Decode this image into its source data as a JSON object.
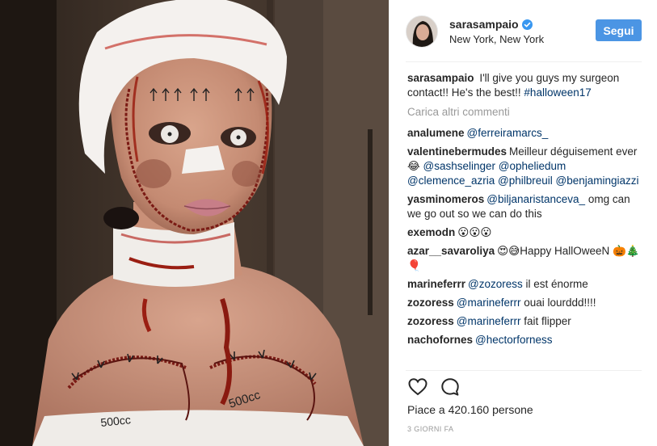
{
  "post": {
    "username": "sarasampaio",
    "location": "New York, New York",
    "follow_label": "Segui",
    "verified": true,
    "caption": {
      "author": "sarasampaio",
      "text": "I'll give you guys my surgeon contact!! He's the best!!",
      "hashtag": "#halloween17"
    },
    "load_more_label": "Carica altri commenti",
    "likes_label": "Piace a 420.160 persone",
    "timestamp": "3 GIORNI FA"
  },
  "comments": [
    {
      "author": "analumene",
      "parts": [
        {
          "t": "mention",
          "v": "@ferreiramarcs_"
        }
      ]
    },
    {
      "author": "valentinebermudes",
      "parts": [
        {
          "t": "text",
          "v": "Meilleur déguisement ever 😂 "
        },
        {
          "t": "mention",
          "v": "@sashselinger"
        },
        {
          "t": "text",
          "v": " "
        },
        {
          "t": "mention",
          "v": "@opheliedum"
        },
        {
          "t": "text",
          "v": " "
        },
        {
          "t": "mention",
          "v": "@clemence_azria"
        },
        {
          "t": "text",
          "v": " "
        },
        {
          "t": "mention",
          "v": "@philbreuil"
        },
        {
          "t": "text",
          "v": " "
        },
        {
          "t": "mention",
          "v": "@benjamingiazzi"
        }
      ]
    },
    {
      "author": "yasminomeros",
      "parts": [
        {
          "t": "mention",
          "v": "@biljanaristanceva_"
        },
        {
          "t": "text",
          "v": " omg can we go out so we can do this"
        }
      ]
    },
    {
      "author": "exemodn",
      "parts": [
        {
          "t": "text",
          "v": "😮😮😮"
        }
      ]
    },
    {
      "author": "azar__savaroliya",
      "parts": [
        {
          "t": "text",
          "v": "😍😅Happy HallOweeN 🎃🎄🎈"
        }
      ]
    },
    {
      "author": "marineferrr",
      "parts": [
        {
          "t": "mention",
          "v": "@zozoress"
        },
        {
          "t": "text",
          "v": " il est énorme"
        }
      ]
    },
    {
      "author": "zozoress",
      "parts": [
        {
          "t": "mention",
          "v": "@marineferrr"
        },
        {
          "t": "text",
          "v": " ouai lourddd!!!!"
        }
      ]
    },
    {
      "author": "zozoress",
      "parts": [
        {
          "t": "mention",
          "v": "@marineferrr"
        },
        {
          "t": "text",
          "v": " fait flipper"
        }
      ]
    },
    {
      "author": "nachofornes",
      "parts": [
        {
          "t": "mention",
          "v": "@hectorforness"
        }
      ]
    }
  ],
  "photo_text": {
    "left_chest": "500cc",
    "right_chest": "500cc"
  },
  "icons": {
    "verified": "verified-badge-icon",
    "like": "heart-icon",
    "comment": "comment-bubble-icon"
  },
  "colors": {
    "accent": "#4b95e4",
    "mention": "#003569",
    "muted": "#999999",
    "verified": "#3897f0"
  }
}
